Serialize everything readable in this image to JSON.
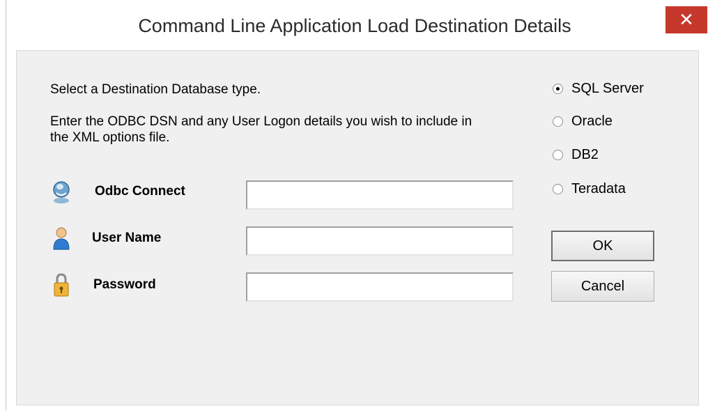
{
  "window": {
    "title": "Command Line Application Load Destination Details",
    "close_glyph": "✕"
  },
  "intro": {
    "line1": "Select a Destination Database type.",
    "line2a": "Enter the ODBC DSN and any User Logon details you wish to include in",
    "line2b": "the XML options file."
  },
  "fields": {
    "odbc": {
      "label": "Odbc Connect",
      "value": "",
      "icon": "odbc-connect-icon"
    },
    "user": {
      "label": "User Name",
      "value": "",
      "icon": "user-icon"
    },
    "password": {
      "label": "Password",
      "value": "",
      "icon": "padlock-icon"
    }
  },
  "db_types": {
    "selected": "SQL Server",
    "options": [
      "SQL Server",
      "Oracle",
      "DB2",
      "Teradata"
    ]
  },
  "buttons": {
    "ok": "OK",
    "cancel": "Cancel"
  },
  "colors": {
    "close_button": "#c7382c",
    "dialog_bg": "#f0f0f0"
  }
}
